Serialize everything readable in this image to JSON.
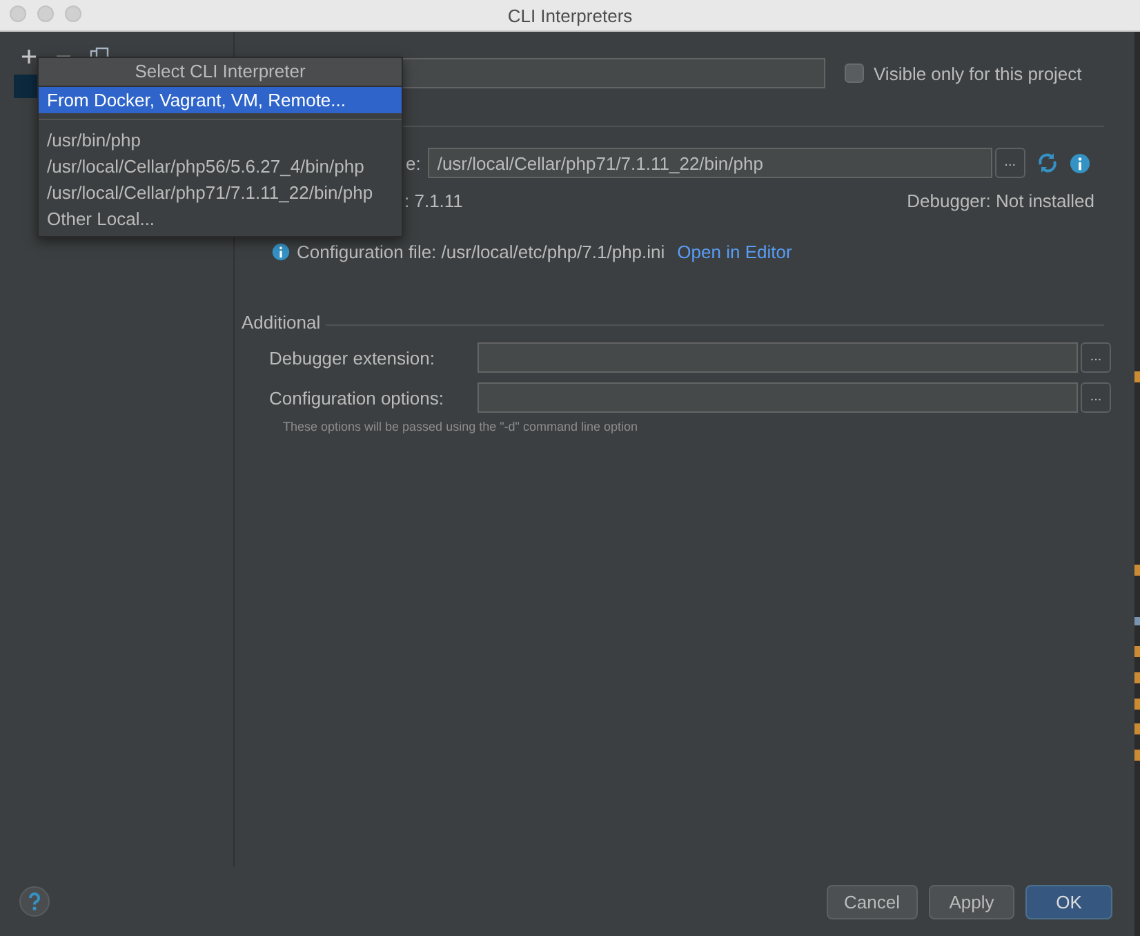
{
  "window": {
    "title": "CLI Interpreters"
  },
  "interpreter_list": {
    "items": [
      {
        "selected": true
      }
    ]
  },
  "popup": {
    "title": "Select CLI Interpreter",
    "items": [
      {
        "label": "From Docker, Vagrant, VM, Remote...",
        "selected": true,
        "separator_after": true
      },
      {
        "label": "/usr/bin/php",
        "selected": false,
        "separator_after": false
      },
      {
        "label": "/usr/local/Cellar/php56/5.6.27_4/bin/php",
        "selected": false,
        "separator_after": false
      },
      {
        "label": "/usr/local/Cellar/php71/7.1.11_22/bin/php",
        "selected": false,
        "separator_after": false
      },
      {
        "label": "Other Local...",
        "selected": false,
        "separator_after": false
      }
    ]
  },
  "visible_only_checkbox": {
    "label": "Visible only for this project",
    "checked": false
  },
  "executable": {
    "label": "e:",
    "value": "/usr/local/Cellar/php71/7.1.11_22/bin/php",
    "browse": "..."
  },
  "version": ": 7.1.11",
  "debugger": "Debugger: Not installed",
  "configuration_file": {
    "text": "Configuration file: /usr/local/etc/php/7.1/php.ini",
    "link": "Open in Editor"
  },
  "additional": {
    "title": "Additional",
    "fields": [
      {
        "label": "Debugger extension:",
        "browse": "..."
      },
      {
        "label": "Configuration options:",
        "browse": "..."
      }
    ],
    "hint": "These options will be passed using the \"-d\" command line option"
  },
  "buttons": [
    {
      "label": "Cancel",
      "default": false
    },
    {
      "label": "Apply",
      "default": false
    },
    {
      "label": "OK",
      "default": true
    }
  ]
}
